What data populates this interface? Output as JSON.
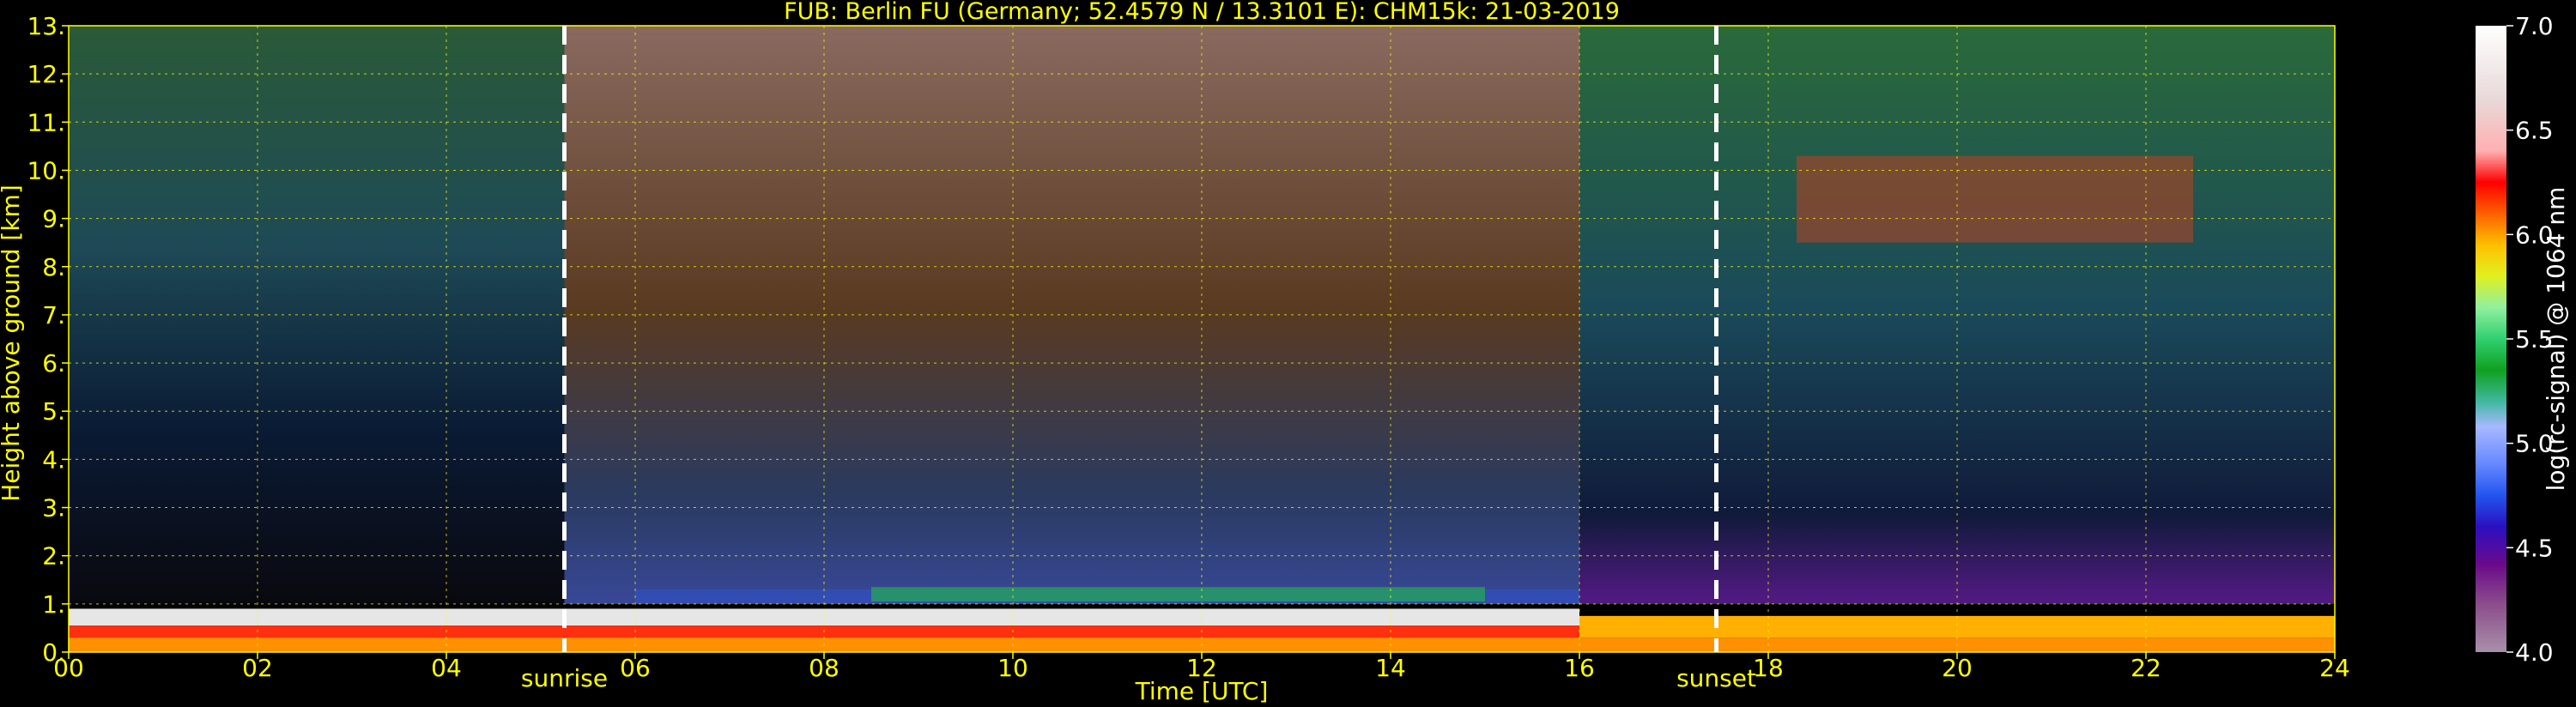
{
  "chart_data": {
    "type": "heatmap",
    "title": "FUB: Berlin FU (Germany; 52.4579 N / 13.3101 E):    CHM15k: 21-03-2019",
    "xlabel": "Time [UTC]",
    "ylabel": "Height above ground [km]",
    "colorbar_label": "log(rc-signal) @ 1064 nm",
    "xlim": [
      0,
      24
    ],
    "ylim": [
      0,
      13
    ],
    "x_ticks": [
      "00",
      "02",
      "04",
      "06",
      "08",
      "10",
      "12",
      "14",
      "16",
      "18",
      "20",
      "22",
      "24"
    ],
    "y_ticks": [
      "0.",
      "1.",
      "2.",
      "3.",
      "4.",
      "5.",
      "6.",
      "7.",
      "8.",
      "9.",
      "10.",
      "11.",
      "12.",
      "13."
    ],
    "colorbar_range": [
      4.0,
      7.0
    ],
    "colorbar_ticks": [
      "4.0",
      "4.5",
      "5.0",
      "5.5",
      "6.0",
      "6.5",
      "7.0"
    ],
    "grid": true,
    "markers": [
      {
        "label": "sunrise",
        "time": 5.25
      },
      {
        "label": "sunset",
        "time": 17.45
      }
    ],
    "colors": {
      "text": "#ffff00",
      "grid": "#ffff00",
      "background": "#000000",
      "marker_line": "#ffffff"
    }
  }
}
